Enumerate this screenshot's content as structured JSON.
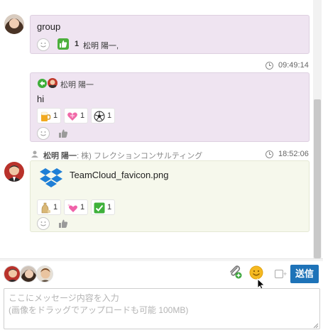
{
  "timeline": {
    "messages": [
      {
        "text": "group",
        "reactions": [
          {
            "emoji": "thumbs-up-green",
            "count": "1",
            "names": "松明 陽一,"
          }
        ]
      },
      {
        "timestamp": "09:49:14",
        "reply_author": "松明 陽一",
        "text": "hi",
        "reactions": [
          {
            "emoji": "beer-icon",
            "count": "1"
          },
          {
            "emoji": "heart-ribbon-icon",
            "count": "1"
          },
          {
            "emoji": "soccer-ball-icon",
            "count": "1"
          }
        ]
      },
      {
        "sender_name": "松明 陽一",
        "sender_company": ": 株) フレクションコンサルティング",
        "timestamp": "18:52:06",
        "file_name": "TeamCloud_favicon.png",
        "reactions": [
          {
            "emoji": "sake-icon",
            "count": "1"
          },
          {
            "emoji": "sparkling-heart-icon",
            "count": "1"
          },
          {
            "emoji": "check-mark-icon",
            "count": "1"
          }
        ]
      }
    ]
  },
  "composer": {
    "send_label": "送信",
    "placeholder": "ここにメッセージ内容を入力\n(画像をドラッグでアップロードも可能 100MB)"
  },
  "colors": {
    "send_button": "#1e73b8",
    "bubble_purple": "#efe4f1",
    "bubble_cream": "#f6f8ec"
  }
}
